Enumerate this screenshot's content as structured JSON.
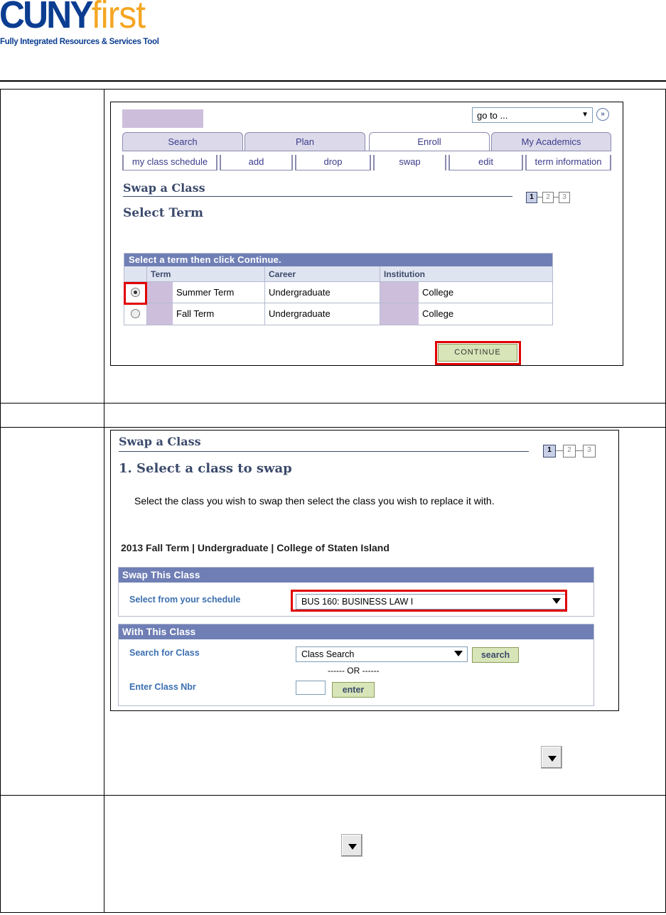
{
  "logo": {
    "cuny": "CUNY",
    "first": "first",
    "tagline": "Fully Integrated Resources & Services Tool"
  },
  "shot1": {
    "goto": {
      "value": "go to ...",
      "button_icon": "double-chevron-right-icon"
    },
    "tabs": [
      "Search",
      "Plan",
      "Enroll",
      "My Academics"
    ],
    "active_tab": "Enroll",
    "subtabs": [
      "my class schedule",
      "add",
      "drop",
      "swap",
      "edit",
      "term information"
    ],
    "active_subtab": "swap",
    "page_title": "Swap a Class",
    "section_title": "Select Term",
    "steps": [
      "1",
      "2",
      "3"
    ],
    "grid": {
      "caption": "Select a term then click Continue.",
      "headers": [
        "Term",
        "Career",
        "Institution"
      ],
      "rows": [
        {
          "term": "Summer Term",
          "career": "Undergraduate",
          "institution": "College",
          "selected": true
        },
        {
          "term": "Fall Term",
          "career": "Undergraduate",
          "institution": "College",
          "selected": false
        }
      ]
    },
    "continue_label": "Continue",
    "highlight_color": "#e00000"
  },
  "shot2": {
    "page_title": "Swap a Class",
    "section_title": "1.  Select a class to swap",
    "steps": [
      "1",
      "2",
      "3"
    ],
    "instructions": "Select the class you wish to swap then select the class you wish to replace it with.",
    "term_line": "2013 Fall Term | Undergraduate | College of Staten Island",
    "swap_panel": {
      "heading": "Swap This Class",
      "label": "Select from your schedule",
      "selected": "BUS 160: BUSINESS LAW I"
    },
    "with_panel": {
      "heading": "With This Class",
      "search_label": "Search for Class",
      "search_select": "Class Search",
      "search_button": "search",
      "or_text": "------ OR ------",
      "nbr_label": "Enter Class Nbr",
      "nbr_value": "",
      "enter_button": "enter"
    }
  },
  "colors": {
    "header_bar": "#6f7fb5",
    "title_text": "#3b4a6b",
    "button_green": "#d8e5b8",
    "mask_purple": "#cdbfdc"
  }
}
